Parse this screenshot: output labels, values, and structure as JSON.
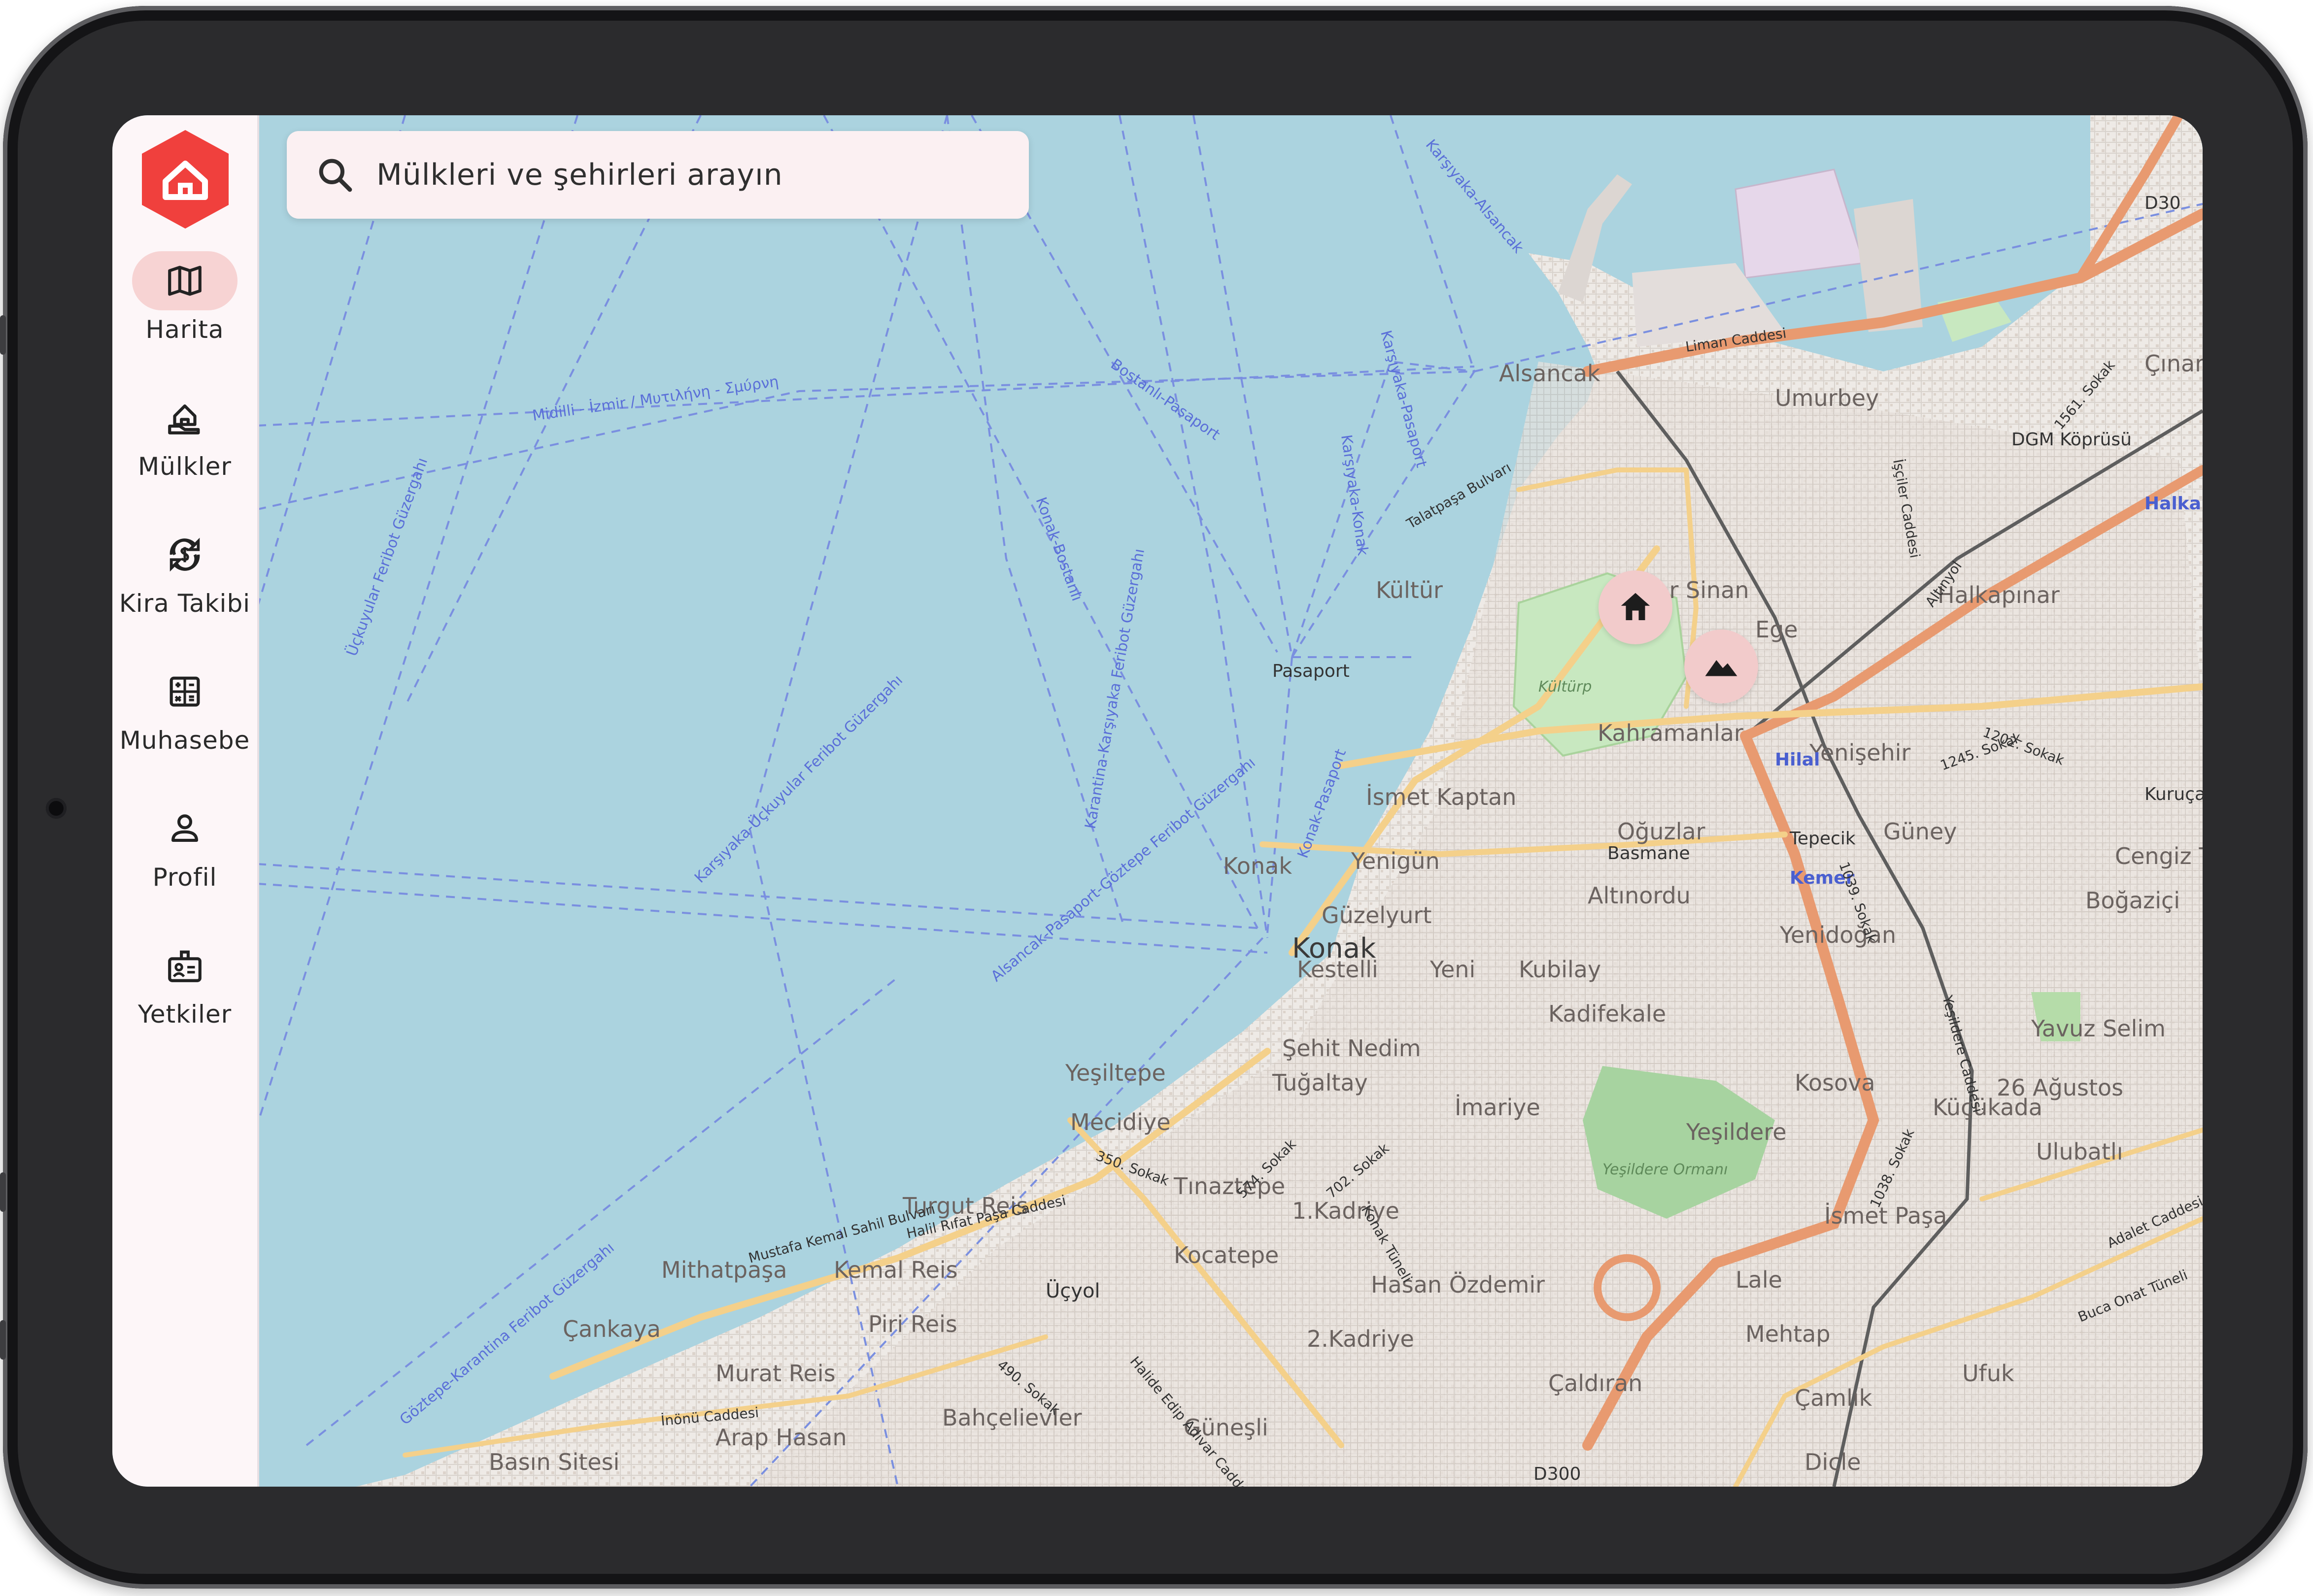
{
  "search": {
    "placeholder": "Mülkleri ve şehirleri arayın"
  },
  "sidebar": {
    "items": [
      {
        "label": "Harita",
        "icon": "map-icon",
        "active": true
      },
      {
        "label": "Mülkler",
        "icon": "property-icon",
        "active": false
      },
      {
        "label": "Kira Takibi",
        "icon": "rent-tracking-icon",
        "active": false
      },
      {
        "label": "Muhasebe",
        "icon": "calculator-icon",
        "active": false
      },
      {
        "label": "Profil",
        "icon": "person-icon",
        "active": false
      },
      {
        "label": "Yetkiler",
        "icon": "badge-icon",
        "active": false
      }
    ]
  },
  "markers": [
    {
      "icon": "home-icon"
    },
    {
      "icon": "landscape-icon"
    }
  ],
  "map": {
    "labels": {
      "alsancak": "Alsancak",
      "umurbey": "Umurbey",
      "mimar_sinan": "Mimar Sinan",
      "kultur": "Kültür",
      "ege": "Ege",
      "halkapinar": "Halkapınar",
      "halkapinar_station": "Halkapınar",
      "pasaport": "Pasaport",
      "kahramanlar": "Kahramanlar",
      "yenisehir": "Yenişehir",
      "ismet_kaptan": "İsmet Kaptan",
      "oguzlar": "Oğuzlar",
      "basmane": "Basmane",
      "tepecik": "Tepecik",
      "guney": "Güney",
      "kurucay": "Kuruçay",
      "konak_small": "Konak",
      "yenigun": "Yenigün",
      "altinordu": "Altınordu",
      "guzelyurt": "Güzelyurt",
      "konak": "Konak",
      "kestelli": "Kestelli",
      "yeni": "Yeni",
      "kubilay": "Kubilay",
      "kadifekale": "Kadifekale",
      "yenidogan": "Yenidoğan",
      "bogazici": "Boğaziçi",
      "cengiz": "Cengiz To",
      "yavuz_selim": "Yavuz Selim",
      "yesiltepe": "Yeşiltepe",
      "sehit_nedim": "Şehit Nedim",
      "tugaltay": "Tuğaltay",
      "kosova": "Kosova",
      "kucukada": "Küçükada",
      "agustos": "26 Ağustos",
      "mecidiye": "Mecidiye",
      "imariye": "İmariye",
      "yesildere": "Yeşildere",
      "ulubatli": "Ulubatlı",
      "tinaztepe": "Tınaztepe",
      "turgut_reis": "Turgut Reis",
      "kadriye1": "1.Kadriye",
      "ismet_pasa": "İsmet Paşa",
      "mithatpasa": "Mithatpaşa",
      "kemal_reis": "Kemal Reis",
      "kocatepe": "Kocatepe",
      "lale": "Lale",
      "hasan_ozdemir": "Hasan Özdemir",
      "ucyol": "Üçyol",
      "cankaya": "Çankaya",
      "piri_reis": "Piri Reis",
      "kadriye2": "2.Kadriye",
      "mehtap": "Mehtap",
      "murat_reis": "Murat Reis",
      "ufuk": "Ufuk",
      "caldiran": "Çaldıran",
      "camlik": "Çamlık",
      "bahcelievler": "Bahçelievler",
      "arap_hasan": "Arap Hasan",
      "gunesli": "Güneşli",
      "basin_sitesi": "Basın Sitesi",
      "dicle": "Dicle",
      "cinarli": "Çınarlı",
      "dgm_koprusu": "DGM Köprüsü",
      "hilal": "Hilal",
      "kemer": "Kemer",
      "liman": "Liman Caddesi",
      "talatpasa": "Talatpaşa Bulvarı",
      "mustafa": "Mustafa Kemal Sahil Bulvarı",
      "halil_rifat": "Halil Rıfat Paşa Caddesi",
      "inonu": "İnönü Caddesi",
      "yesildere_ormani": "Yeşildere Ormanı",
      "kulturpark": "Kültürp",
      "d300_road": "D300",
      "d30": "D30",
      "ferry1": "Göztepe-Karantina Feribot Güzergahı",
      "ferry2": "Karşıyaka-Üçkuyular Feribot Güzergahı",
      "ferry3": "Alsancak-Pasaport-Göztepe Feribot Güzergahı",
      "ferry4": "Karantina-Karşıyaka Feribot Güzergahı",
      "ferry5": "Bostanlı-Pasaport",
      "ferry6": "Karşıyaka-Pasaport",
      "ferry7": "Karşıyaka-Konak",
      "ferry8": "Konak-Bostanlı",
      "ferry9": "Konak-Pasaport",
      "ferry10": "Karşıyaka-Alsancak",
      "ferry11": "Midilli - İzmir / Μυτιλήνη - Σμύρνη",
      "ferry12": "Üçkuyular Feribot Güzergahı",
      "sokak1202": "1202. Sokak",
      "sokak1245": "1245. Sokak",
      "sokak1561": "1561. Sokak",
      "sokak350": "350. Sokak",
      "sokak574": "574. Sokak",
      "sokak702": "702. Sokak",
      "sokak490": "490. Sokak",
      "sokak1039": "1039. Sokak",
      "sokak1038": "1038. Sokak",
      "adalet": "Adalet Caddesi",
      "buca_onat": "Buca Onat Tüneli",
      "konak_tuneli": "Konak Tüneli",
      "halide_edip": "Halide Edip Adıvar Caddesi",
      "yesildere_cad": "Yeşildere Caddesi",
      "isciler": "İşçiler Caddesi",
      "altinyol": "Altınyol"
    }
  }
}
